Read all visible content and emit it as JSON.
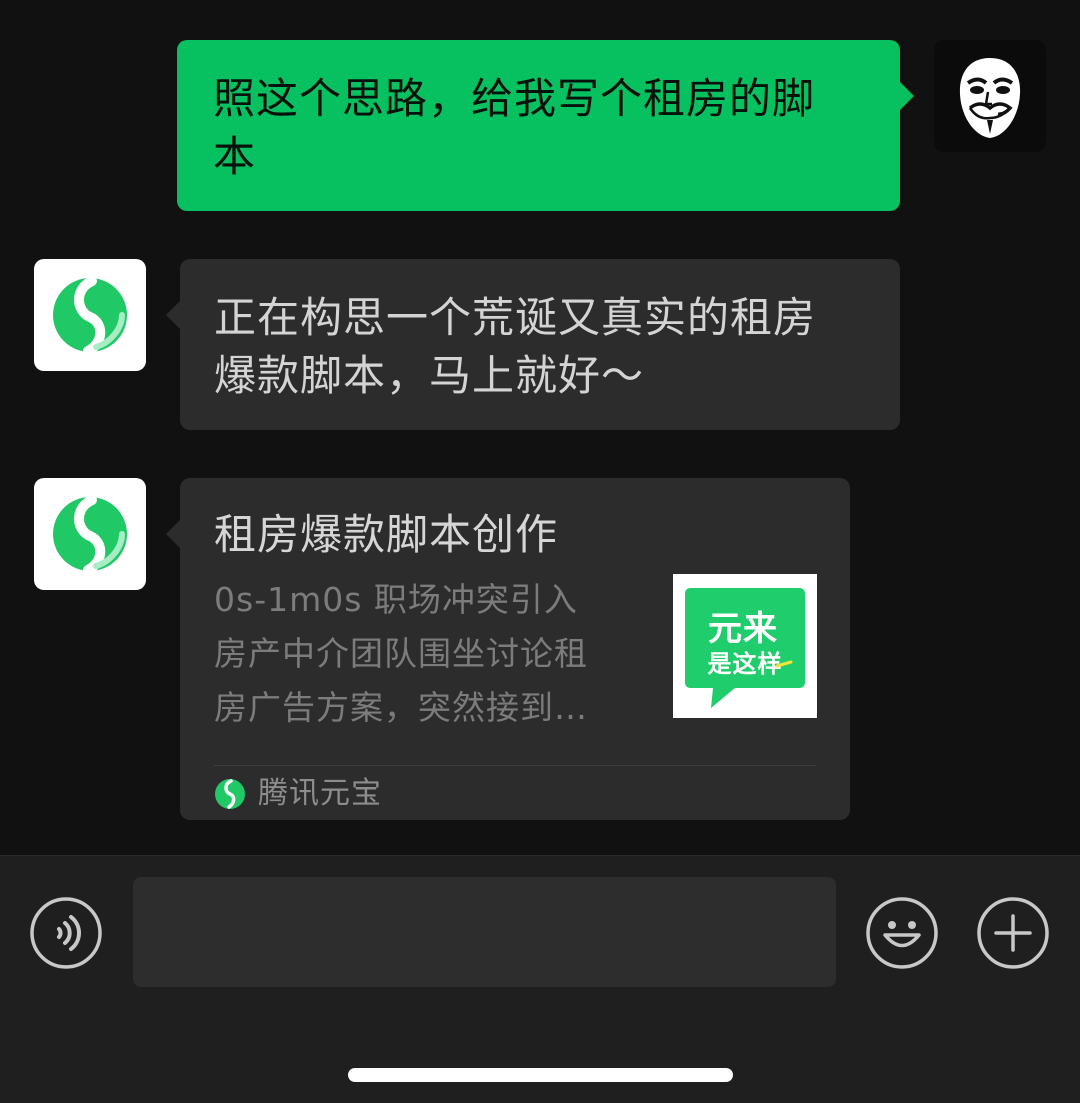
{
  "messages": [
    {
      "sender": "me",
      "avatar_icon": "guy-fawkes-mask-icon",
      "lines": [
        "照这个思路，给我写个租房的脚",
        "本"
      ]
    },
    {
      "sender": "bot",
      "avatar_icon": "tencent-yuanbao-logo-icon",
      "lines": [
        "正在构思一个荒诞又真实的租房",
        "爆款脚本，马上就好～"
      ]
    }
  ],
  "card": {
    "avatar_icon": "tencent-yuanbao-logo-icon",
    "title": "租房爆款脚本创作",
    "desc_lines": [
      "0s-1m0s 职场冲突引入",
      "房产中介团队围坐讨论租",
      "房广告方案，突然接到…"
    ],
    "thumbnail": {
      "line1": "元来",
      "line2": "是这样",
      "icon": "speech-bubble-icon"
    },
    "source_label": "腾讯元宝",
    "source_icon": "tencent-yuanbao-logo-icon"
  },
  "input_bar": {
    "voice_icon": "voice-icon",
    "emoji_icon": "smiley-icon",
    "plus_icon": "plus-icon",
    "input_value": ""
  },
  "colors": {
    "accent": "#07c160",
    "background": "#111111",
    "incoming_bubble": "#2c2c2c",
    "input_bar": "#1f1f1f"
  }
}
